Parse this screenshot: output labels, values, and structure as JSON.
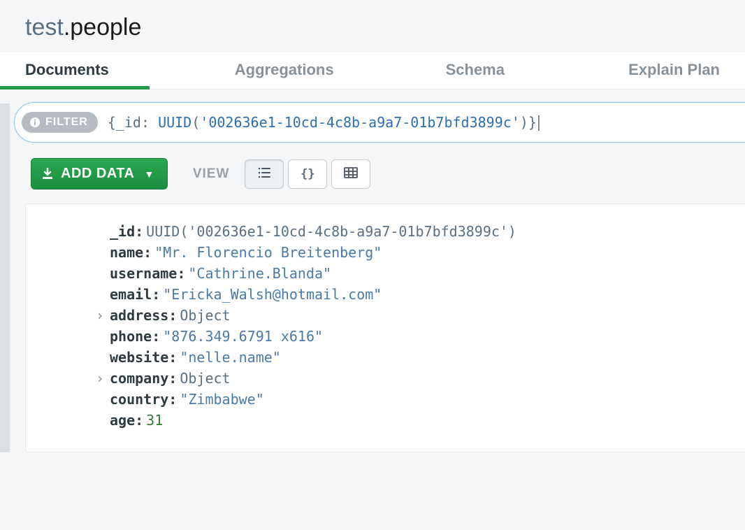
{
  "header": {
    "database": "test",
    "collection": "people"
  },
  "tabs": [
    {
      "label": "Documents",
      "active": true
    },
    {
      "label": "Aggregations",
      "active": false
    },
    {
      "label": "Schema",
      "active": false
    },
    {
      "label": "Explain Plan",
      "active": false
    }
  ],
  "filter": {
    "pill_label": "FILTER",
    "query_prefix": "{_id: ",
    "query_func": "UUID",
    "query_open": "(",
    "query_str": "'002636e1-10cd-4c8b-a9a7-01b7bfd3899c'",
    "query_close": ")}"
  },
  "toolbar": {
    "add_data_label": "ADD DATA",
    "view_label": "VIEW"
  },
  "document": {
    "fields": [
      {
        "key": "_id",
        "kind": "uuid",
        "value": "UUID('002636e1-10cd-4c8b-a9a7-01b7bfd3899c')"
      },
      {
        "key": "name",
        "kind": "string",
        "value": "\"Mr. Florencio Breitenberg\""
      },
      {
        "key": "username",
        "kind": "string",
        "value": "\"Cathrine.Blanda\""
      },
      {
        "key": "email",
        "kind": "string",
        "value": "\"Ericka_Walsh@hotmail.com\""
      },
      {
        "key": "address",
        "kind": "object",
        "value": "Object",
        "expandable": true
      },
      {
        "key": "phone",
        "kind": "string",
        "value": "\"876.349.6791 x616\""
      },
      {
        "key": "website",
        "kind": "string",
        "value": "\"nelle.name\""
      },
      {
        "key": "company",
        "kind": "object",
        "value": "Object",
        "expandable": true
      },
      {
        "key": "country",
        "kind": "string",
        "value": "\"Zimbabwe\""
      },
      {
        "key": "age",
        "kind": "number",
        "value": "31"
      }
    ]
  }
}
